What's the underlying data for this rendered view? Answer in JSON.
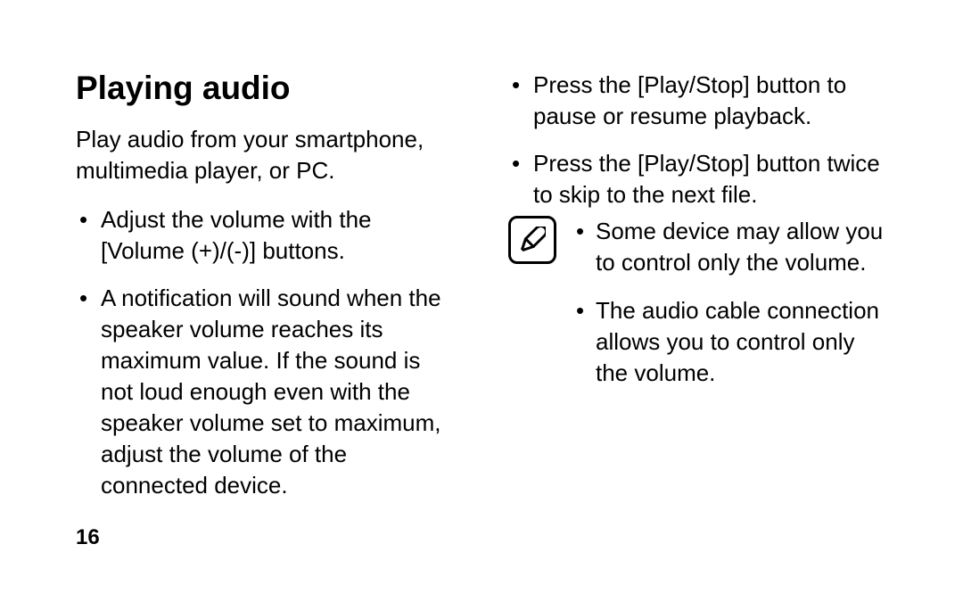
{
  "heading": "Playing audio",
  "intro": "Play audio from your smartphone, multimedia player, or PC.",
  "bullets_main": [
    "Adjust the volume with the [Volume (+)/(-)] buttons.",
    "A notification will sound when the speaker volume reaches its maximum value. If the sound is not loud enough even with the speaker volume set to maximum, adjust the volume of the connected device.",
    "Press the [Play/Stop] button to pause or resume playback.",
    "Press the [Play/Stop] button twice to skip to the next file."
  ],
  "note": {
    "icon": "pencil-note-icon",
    "items": [
      "Some device may allow you to control only the volume.",
      "The audio cable connection allows you to control only the volume."
    ]
  },
  "page_number": "16"
}
